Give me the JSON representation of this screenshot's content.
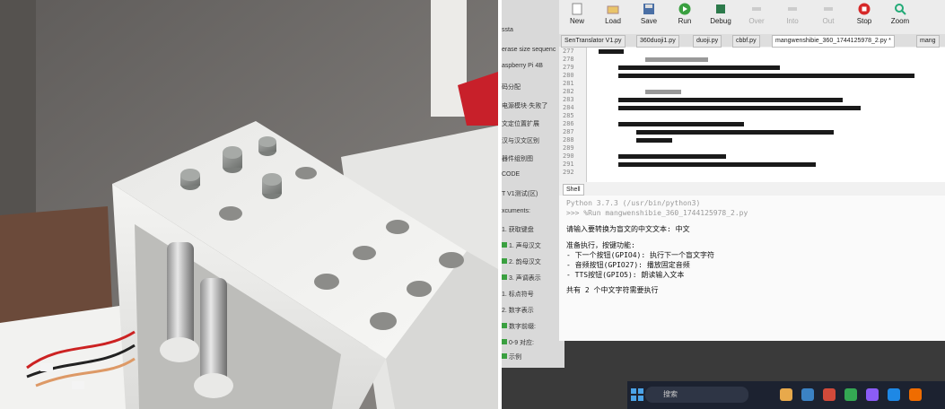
{
  "ide": {
    "toolbar": {
      "new_label": "New",
      "load_label": "Load",
      "save_label": "Save",
      "run_label": "Run",
      "debug_label": "Debug",
      "over_label": "Over",
      "into_label": "Into",
      "out_label": "Out",
      "stop_label": "Stop",
      "zoom_label": "Zoom"
    },
    "tabs": [
      "SenTranslator V1.py",
      "360duoji1.py",
      "duoji.py",
      "cbbf.py",
      "mangwenshibie_360_1744125978_2.py *",
      "mang"
    ],
    "line_numbers": [
      "277",
      "278",
      "279",
      "280",
      "281",
      "282",
      "283",
      "284",
      "285",
      "286",
      "287",
      "288",
      "289",
      "290",
      "291",
      "292"
    ],
    "shell_tab_label": "Shell",
    "shell_lines": [
      "Python 3.7.3 (/usr/bin/python3)",
      ">>> %Run mangwenshibie_360_1744125978_2.py",
      "请输入要转换为盲文的中文文本: 中文",
      "准备执行，按键功能:",
      "- 下一个按钮(GPIO4): 执行下一个盲文字符",
      "- 音频按钮(GPIO27): 播放固定音频",
      "- TTS按钮(GPIO5): 朗读输入文本",
      "共有 2 个中文字符需要执行"
    ]
  },
  "sidebar_items": [
    "ssta",
    "erase size sequenc",
    "aspberry Pi 4B",
    "码分配",
    "电源模块·失败了",
    "文定位置扩展",
    "汉与汉文区别",
    "器件组别图",
    "CODE",
    "T V1测试(区)",
    "xcuments:",
    "1. 获取键盘",
    "1. 声母汉文",
    "2. 韵母汉文",
    "3. 声调表示",
    "1. 标点符号",
    "2. 数字表示",
    "数字前缀:",
    "0-9 对应:",
    "示例"
  ],
  "taskbar": {
    "search_placeholder": "搜索"
  }
}
